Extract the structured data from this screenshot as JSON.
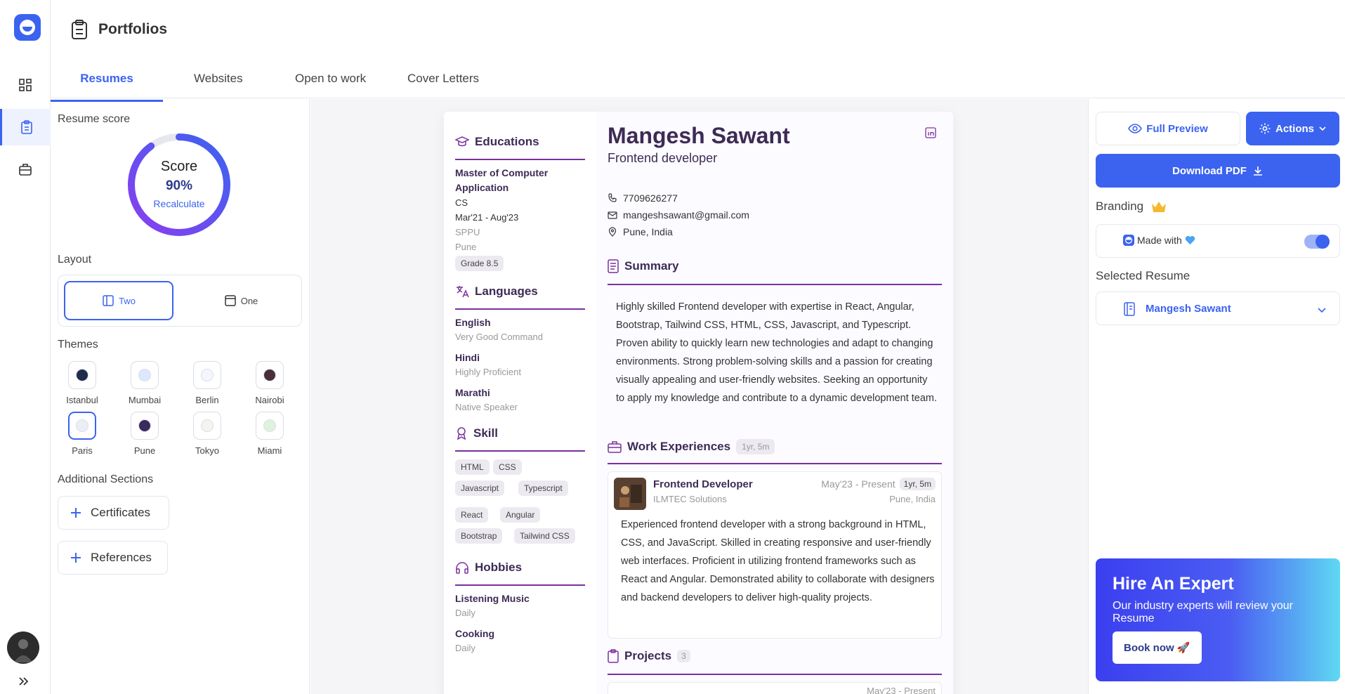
{
  "app": {
    "title": "Portfolios"
  },
  "tabs": [
    {
      "label": "Resumes",
      "active": true
    },
    {
      "label": "Websites"
    },
    {
      "label": "Open to work"
    },
    {
      "label": "Cover Letters"
    }
  ],
  "sidebar": {
    "score_label": "Resume score",
    "score_title": "Score",
    "score_value": "90%",
    "score_fraction": 0.9,
    "recalculate": "Recalculate",
    "layout_label": "Layout",
    "layout_two": "Two",
    "layout_one": "One",
    "themes_label": "Themes",
    "themes": [
      {
        "name": "Istanbul",
        "color": "#1f2d4a"
      },
      {
        "name": "Mumbai",
        "color": "#dbe8ff"
      },
      {
        "name": "Berlin",
        "color": "#f4f6fb"
      },
      {
        "name": "Nairobi",
        "color": "#4a2f38"
      },
      {
        "name": "Paris",
        "color": "#eceef5",
        "selected": true
      },
      {
        "name": "Pune",
        "color": "#3b2a5e"
      },
      {
        "name": "Tokyo",
        "color": "#f3f5ee"
      },
      {
        "name": "Miami",
        "color": "#dff2dc"
      }
    ],
    "additional_label": "Additional Sections",
    "add_certificates": "Certificates",
    "add_references": "References"
  },
  "resume": {
    "name": "Mangesh Sawant",
    "role": "Frontend developer",
    "phone": "7709626277",
    "email": "mangeshsawant@gmail.com",
    "location": "Pune, India",
    "educations_title": "Educations",
    "edu_degree_1": "Master of Computer",
    "edu_degree_2": "Application",
    "edu_field": "CS",
    "edu_dates": "Mar'21 - Aug'23",
    "edu_school": "SPPU",
    "edu_city": "Pune",
    "edu_grade": "Grade 8.5",
    "languages_title": "Languages",
    "languages": [
      {
        "name": "English",
        "level": "Very Good Command"
      },
      {
        "name": "Hindi",
        "level": "Highly Proficient"
      },
      {
        "name": "Marathi",
        "level": "Native Speaker"
      }
    ],
    "skill_title": "Skill",
    "skills": [
      "HTML",
      "CSS",
      "Javascript",
      "Typescript",
      "React",
      "Angular",
      "Bootstrap",
      "Tailwind CSS"
    ],
    "hobbies_title": "Hobbies",
    "hobbies": [
      {
        "name": "Listening Music",
        "freq": "Daily"
      },
      {
        "name": "Cooking",
        "freq": "Daily"
      }
    ],
    "summary_title": "Summary",
    "summary": "Highly skilled Frontend developer with expertise in React, Angular, Bootstrap, Tailwind CSS, HTML, CSS, Javascript, and Typescript. Proven ability to quickly learn new technologies and adapt to changing environments. Strong problem-solving skills and a passion for creating visually appealing and user-friendly websites. Seeking an opportunity to apply my knowledge and contribute to a dynamic development team.",
    "work_title": "Work Experiences",
    "work_duration": "1yr, 5m",
    "job_title": "Frontend Developer",
    "job_company": "ILMTEC Solutions",
    "job_dates": "May'23 - Present",
    "job_duration": "1yr, 5m",
    "job_location": "Pune, India",
    "job_desc": "Experienced frontend developer with a strong background in HTML, CSS, and JavaScript. Skilled in creating responsive and user-friendly web interfaces. Proficient in utilizing frontend frameworks such as React and Angular. Demonstrated ability to collaborate with designers and backend developers to deliver high-quality projects.",
    "projects_title": "Projects",
    "projects_count": "3",
    "project_dates_partial": "May'23 - Present"
  },
  "right": {
    "full_preview": "Full Preview",
    "actions": "Actions",
    "download": "Download PDF",
    "branding": "Branding",
    "made_with": "Made with",
    "branding_on": true,
    "selected_resume_label": "Selected Resume",
    "selected_resume": "Mangesh Sawant",
    "hire_title": "Hire An Expert",
    "hire_sub": "Our industry experts will review your Resume",
    "book_now": "Book now 🚀"
  },
  "colors": {
    "accent": "#3b63f0",
    "resume_accent": "#7b2f9e"
  }
}
